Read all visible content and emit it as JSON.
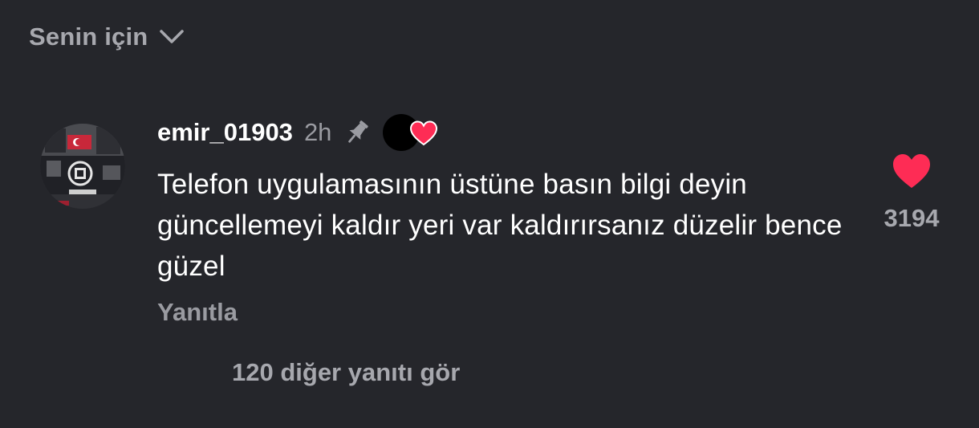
{
  "header": {
    "sort_label": "Senin için",
    "sort_icon": "chevron-down-icon"
  },
  "comment": {
    "username": "emir_01903",
    "timestamp": "2h",
    "pinned_icon": "pin-icon",
    "creator_liked_icon": "heart-icon",
    "text": "Telefon uygulamasının üstüne basın bilgi deyin güncellemeyi kaldır yeri var kaldırırsanız düzelir bence güzel",
    "reply_label": "Yanıtla",
    "like_count": "3194",
    "like_icon": "heart-icon",
    "liked": true
  },
  "replies": {
    "view_label": "120 diğer yanıtı gör"
  },
  "colors": {
    "background": "#25262b",
    "heart": "#fe2c55",
    "muted_text": "#9a9ba1",
    "primary_text": "#ffffff"
  }
}
